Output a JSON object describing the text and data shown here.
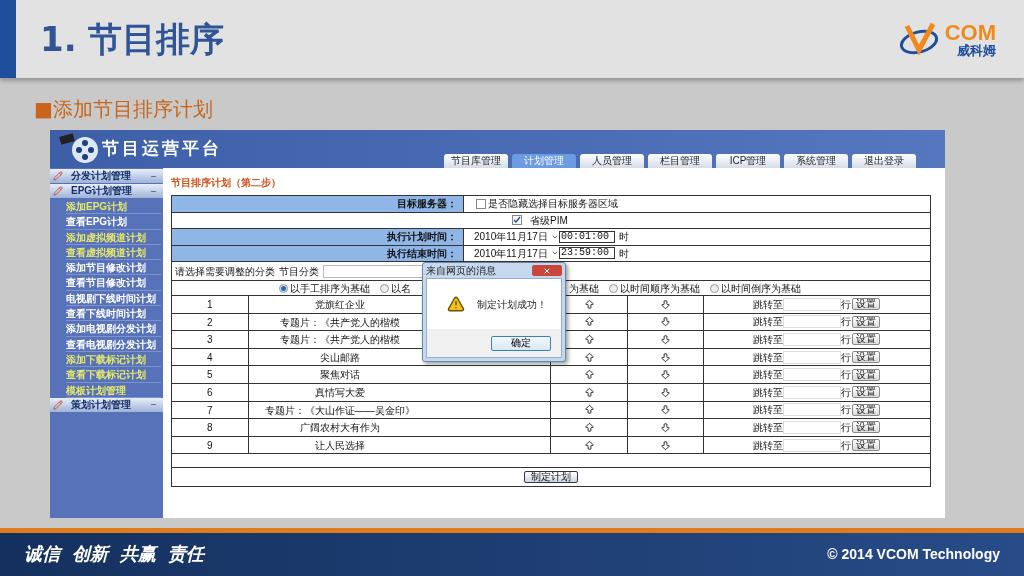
{
  "slide": {
    "title": "1. 节目排序",
    "logo_text": "COM",
    "logo_subtitle": "威科姆",
    "bullet": "■添加节目排序计划",
    "slogans": [
      "诚信",
      "创新",
      "共赢",
      "责任"
    ],
    "copyright": "© 2014 VCOM Technology"
  },
  "app": {
    "title": "节目运营平台",
    "tabs": [
      {
        "label": "节目库管理",
        "selected": false
      },
      {
        "label": "计划管理",
        "selected": true
      },
      {
        "label": "人员管理",
        "selected": false
      },
      {
        "label": "栏目管理",
        "selected": false
      },
      {
        "label": "ICP管理",
        "selected": false
      },
      {
        "label": "系统管理",
        "selected": false
      },
      {
        "label": "退出登录",
        "selected": false
      }
    ],
    "sidebar": [
      {
        "label": "分发计划管理"
      },
      {
        "label": "EPG计划管理",
        "children": [
          {
            "label": "添加EPG计划",
            "color": "#e6e86a"
          },
          {
            "label": "查看EPG计划",
            "color": "#ffffff"
          },
          {
            "label": "添加虚拟频道计划",
            "color": "#e6e86a"
          },
          {
            "label": "查看虚拟频道计划",
            "color": "#e6e86a"
          },
          {
            "label": "添加节目修改计划",
            "color": "#ffffff"
          },
          {
            "label": "查看节目修改计划",
            "color": "#ffffff"
          },
          {
            "label": "电视剧下线时间计划",
            "color": "#ffffff"
          },
          {
            "label": "查看下线时间计划",
            "color": "#ffffff"
          },
          {
            "label": "添加电视剧分发计划",
            "color": "#ffffff"
          },
          {
            "label": "查看电视剧分发计划",
            "color": "#ffffff"
          },
          {
            "label": "添加下载标记计划",
            "color": "#e6e86a"
          },
          {
            "label": "查看下载标记计划",
            "color": "#e6e86a"
          },
          {
            "label": "模板计划管理",
            "color": "#e6e86a"
          }
        ]
      },
      {
        "label": "策划计划管理"
      }
    ],
    "page_title": "节目排序计划（第二步）",
    "form": {
      "server_label": "目标服务器：",
      "hide_checkbox": {
        "label": "是否隐藏选择目标服务器区域",
        "checked": false
      },
      "server_checkbox": {
        "label": "省级PIM",
        "checked": true
      },
      "times": [
        {
          "label": "执行计划时间：",
          "date": "2010年11月17日",
          "time": "00:01:00",
          "unit": "时"
        },
        {
          "label": "执行结束时间：",
          "date": "2010年11月17日",
          "time": "23:59:00",
          "unit": "时"
        }
      ]
    },
    "category": {
      "label": "请选择需要调整的分类",
      "field_label": "节目分类"
    },
    "sort_options": [
      {
        "label": "以手工排序为基础",
        "selected": true
      },
      {
        "label": "以名",
        "tail": "为基础",
        "selected": false
      },
      {
        "label": "以时间顺序为基础",
        "selected": false
      },
      {
        "label": "以时间倒序为基础",
        "selected": false
      }
    ],
    "rows": [
      {
        "index": "1",
        "name": "党旗红企业",
        "jump_label": "跳转至",
        "unit": "行",
        "button": "设置"
      },
      {
        "index": "2",
        "name": "专题片：《共产党人的楷模",
        "jump_label": "跳转至",
        "unit": "行",
        "button": "设置"
      },
      {
        "index": "3",
        "name": "专题片：《共产党人的楷模",
        "jump_label": "跳转至",
        "unit": "行",
        "button": "设置"
      },
      {
        "index": "4",
        "name": "尖山邮路",
        "jump_label": "跳转至",
        "unit": "行",
        "button": "设置"
      },
      {
        "index": "5",
        "name": "聚焦对话",
        "jump_label": "跳转至",
        "unit": "行",
        "button": "设置"
      },
      {
        "index": "6",
        "name": "真情写大爱",
        "jump_label": "跳转至",
        "unit": "行",
        "button": "设置"
      },
      {
        "index": "7",
        "name": "专题片：《大山作证——吴金印》",
        "jump_label": "跳转至",
        "unit": "行",
        "button": "设置"
      },
      {
        "index": "8",
        "name": "广阔农村大有作为",
        "jump_label": "跳转至",
        "unit": "行",
        "button": "设置"
      },
      {
        "index": "9",
        "name": "让人民选择",
        "jump_label": "跳转至",
        "unit": "行",
        "button": "设置"
      }
    ],
    "submit": "制定计划",
    "dialog": {
      "title": "来自网页的消息",
      "message": "制定计划成功！",
      "ok": "确定"
    }
  }
}
